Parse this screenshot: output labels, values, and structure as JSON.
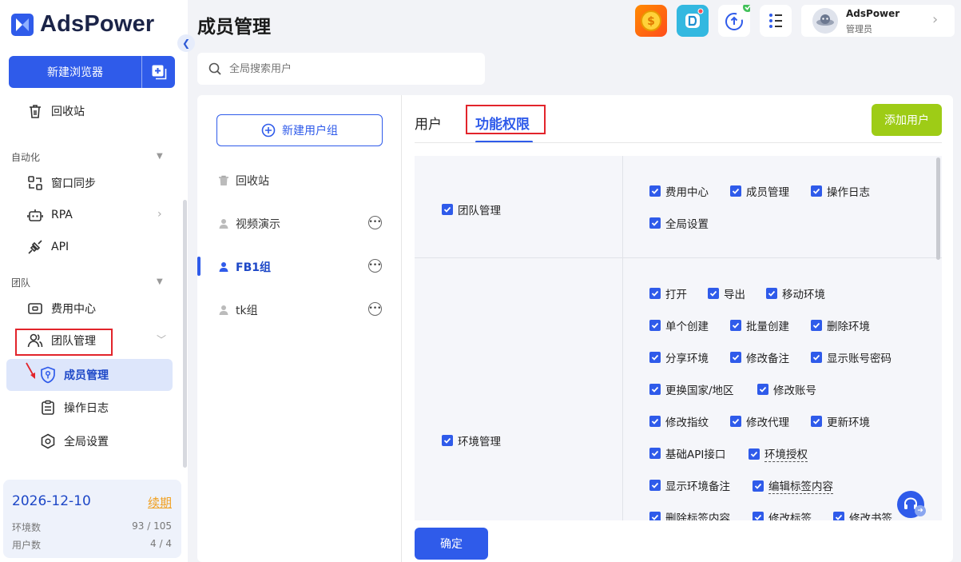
{
  "app": {
    "name": "AdsPower",
    "accent": "#2f5bea"
  },
  "sidebar": {
    "new_browser_label": "新建浏览器",
    "recycle_bin": "回收站",
    "automation_section": "自动化",
    "window_sync": "窗口同步",
    "rpa": "RPA",
    "api": "API",
    "team_section": "团队",
    "billing_center": "费用中心",
    "team_management": "团队管理",
    "member_management": "成员管理",
    "operation_log": "操作日志",
    "global_settings": "全局设置",
    "expiry": {
      "date": "2026-12-10",
      "renew_label": "续期",
      "env_count_label": "环境数",
      "env_count_value": "93 / 105",
      "user_count_label": "用户数",
      "user_count_value": "4 / 4"
    }
  },
  "header": {
    "title": "成员管理",
    "user_name": "AdsPower",
    "user_role": "管理员"
  },
  "search": {
    "placeholder": "全局搜索用户"
  },
  "groups": {
    "new_group_label": "新建用户组",
    "items": [
      {
        "label": "回收站"
      },
      {
        "label": "视频演示"
      },
      {
        "label": "FB1组"
      },
      {
        "label": "tk组"
      }
    ],
    "active_index": 2
  },
  "tabs": {
    "users": "用户",
    "permissions": "功能权限",
    "active": "permissions"
  },
  "add_user_label": "添加用户",
  "permissions": {
    "team_management": {
      "label": "团队管理",
      "items": [
        "费用中心",
        "成员管理",
        "操作日志",
        "全局设置"
      ]
    },
    "environment_management": {
      "label": "环境管理",
      "items": [
        "打开",
        "导出",
        "移动环境",
        "单个创建",
        "批量创建",
        "删除环境",
        "分享环境",
        "修改备注",
        "显示账号密码",
        "更换国家/地区",
        "修改账号",
        "修改指纹",
        "修改代理",
        "更新环境",
        "基础API接口",
        "环境授权",
        "显示环境备注",
        "编辑标签内容",
        "删除标签内容",
        "修改标签",
        "修改书签"
      ]
    }
  },
  "confirm_label": "确定"
}
